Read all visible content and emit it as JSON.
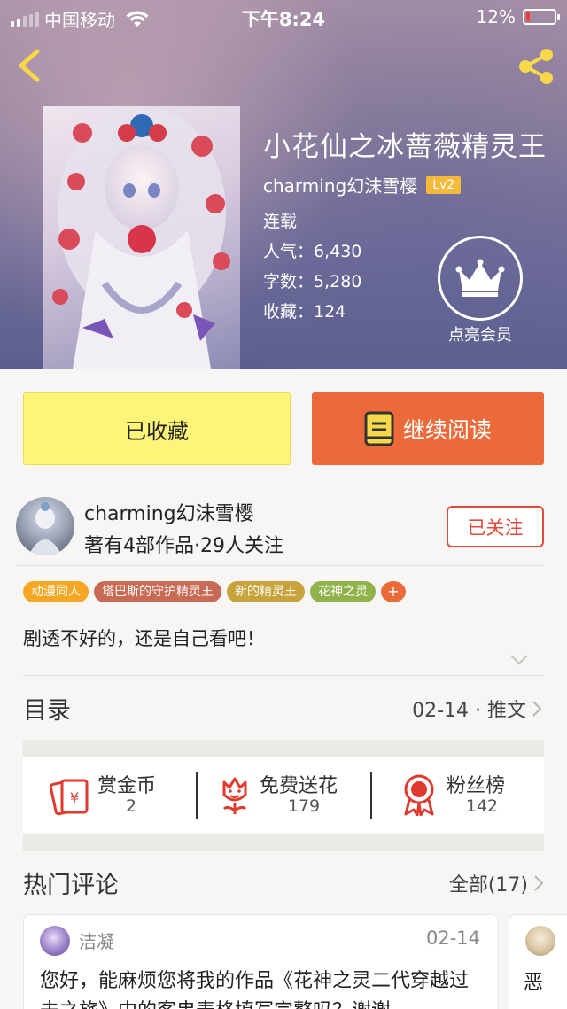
{
  "statusbar": {
    "carrier": "中国移动",
    "time": "下午8:24",
    "battery_percent": "12%",
    "battery_level": 0.12,
    "signal_bars": 5,
    "signal_filled": 2
  },
  "book": {
    "title": "小花仙之冰蔷薇精灵王",
    "author": "charming幻沫雪樱",
    "level": "Lv2",
    "status": "连载",
    "popularity": "人气：6,430",
    "word_count": "字数：5,280",
    "collections": "收藏：124",
    "vip_label": "点亮会员"
  },
  "actions": {
    "collected_label": "已收藏",
    "continue_label": "继续阅读"
  },
  "author": {
    "name": "charming幻沫雪樱",
    "stats": "著有4部作品·29人关注",
    "follow_label": "已关注"
  },
  "tags": [
    {
      "label": "动漫同人",
      "color": "#f5a623"
    },
    {
      "label": "塔巴斯的守护精灵王",
      "color": "#c96a55"
    },
    {
      "label": "新的精灵王",
      "color": "#c8a23a"
    },
    {
      "label": "花神之灵",
      "color": "#8fb34a"
    },
    {
      "label": "+",
      "color": "#ea6a3a"
    }
  ],
  "intro": "剧透不好的，还是自己看吧！",
  "catalog": {
    "title": "目录",
    "latest": "02-14 · 推文"
  },
  "stats": [
    {
      "label": "赏金币",
      "value": "2",
      "icon": "red-envelope-icon"
    },
    {
      "label": "免费送花",
      "value": "179",
      "icon": "flower-icon"
    },
    {
      "label": "粉丝榜",
      "value": "142",
      "icon": "medal-icon"
    }
  ],
  "comments": {
    "title": "热门评论",
    "all_label": "全部(17)",
    "items": [
      {
        "user": "洁凝",
        "date": "02-14",
        "text": "您好，能麻烦您将我的作品《花神之灵二代穿越过去之旅》中的客串表格填写完整吗？谢谢"
      },
      {
        "text": "恶"
      }
    ]
  },
  "colors": {
    "accent_orange": "#ec6a3a",
    "collected_yellow": "#fcf57a",
    "follow_red": "#e34a3a",
    "lv_badge": "#f5b93c"
  }
}
